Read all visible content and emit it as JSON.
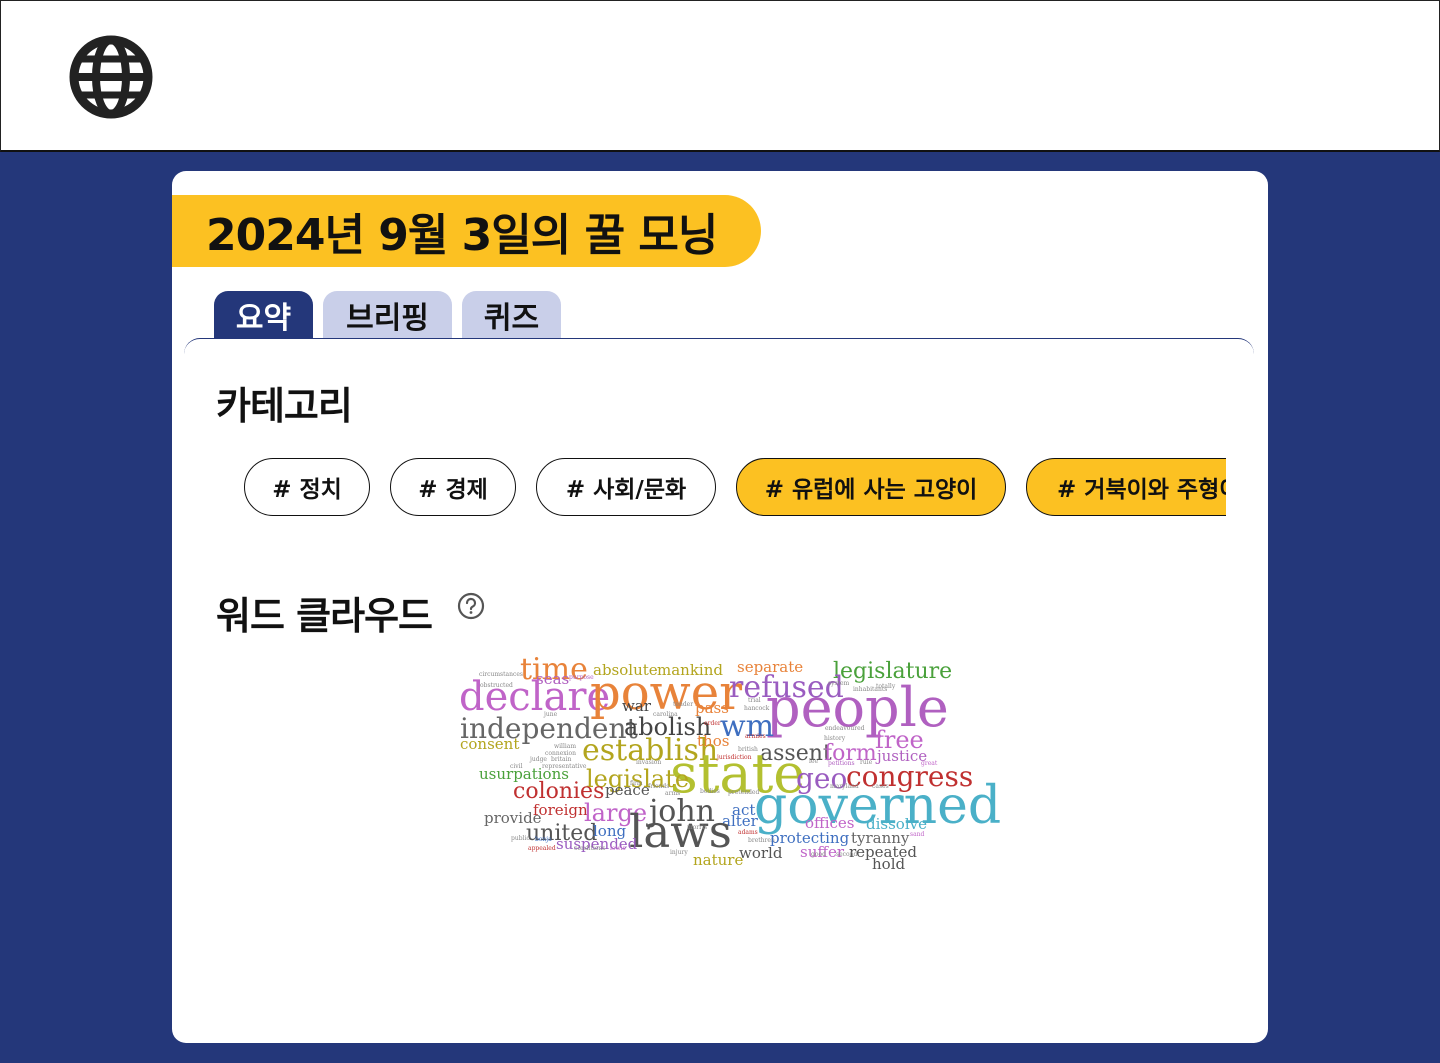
{
  "header": {
    "logo_icon": "globe-icon"
  },
  "banner": {
    "title": "2024년 9월 3일의 꿀 모닝",
    "color": "#fcc122"
  },
  "tabs": [
    {
      "label": "요약",
      "active": true
    },
    {
      "label": "브리핑",
      "active": false
    },
    {
      "label": "퀴즈",
      "active": false
    }
  ],
  "category": {
    "title": "카테고리",
    "chips": [
      {
        "label": "# 정치",
        "style": "white"
      },
      {
        "label": "# 경제",
        "style": "white"
      },
      {
        "label": "# 사회/문화",
        "style": "white"
      },
      {
        "label": "# 유럽에 사는 고양이",
        "style": "yellow"
      },
      {
        "label": "# 거북이와 주형이",
        "style": "yellow"
      }
    ]
  },
  "wordcloud": {
    "title": "워드 클라우드",
    "help_icon": "question-circle-icon",
    "words": [
      {
        "t": "time",
        "c": "#e8833a"
      },
      {
        "t": "absolute",
        "c": "#b3a51e"
      },
      {
        "t": "mankind",
        "c": "#b3a51e"
      },
      {
        "t": "separate",
        "c": "#e8833a"
      },
      {
        "t": "legislature",
        "c": "#4aa13b"
      },
      {
        "t": "circumstances",
        "c": "#888"
      },
      {
        "t": "seas",
        "c": "#b060c0"
      },
      {
        "t": "purpose",
        "c": "#b060c0"
      },
      {
        "t": "obstructed",
        "c": "#888"
      },
      {
        "t": "declare",
        "c": "#c064c8"
      },
      {
        "t": "power",
        "c": "#e8833a"
      },
      {
        "t": "refused",
        "c": "#9a5cc0"
      },
      {
        "t": "system",
        "c": "#888"
      },
      {
        "t": "inhabitants",
        "c": "#888"
      },
      {
        "t": "totally",
        "c": "#888"
      },
      {
        "t": "people",
        "c": "#b060c0"
      },
      {
        "t": "war",
        "c": "#444"
      },
      {
        "t": "tender",
        "c": "#888"
      },
      {
        "t": "pass",
        "c": "#e8833a"
      },
      {
        "t": "trial",
        "c": "#888"
      },
      {
        "t": "hancock",
        "c": "#888"
      },
      {
        "t": "june",
        "c": "#888"
      },
      {
        "t": "carolina",
        "c": "#888"
      },
      {
        "t": "independent",
        "c": "#666"
      },
      {
        "t": "abolish",
        "c": "#444"
      },
      {
        "t": "order",
        "c": "#c03030"
      },
      {
        "t": "wm",
        "c": "#3f6fc0"
      },
      {
        "t": "endeavoured",
        "c": "#888"
      },
      {
        "t": "history",
        "c": "#888"
      },
      {
        "t": "consent",
        "c": "#b3a51e"
      },
      {
        "t": "establish",
        "c": "#b3a51e"
      },
      {
        "t": "thos",
        "c": "#e8833a"
      },
      {
        "t": "armies",
        "c": "#c03030"
      },
      {
        "t": "free",
        "c": "#c064c8"
      },
      {
        "t": "william",
        "c": "#888"
      },
      {
        "t": "connexion",
        "c": "#888"
      },
      {
        "t": "assent",
        "c": "#555"
      },
      {
        "t": "form",
        "c": "#c064c8"
      },
      {
        "t": "justice",
        "c": "#b060c0"
      },
      {
        "t": "judge",
        "c": "#888"
      },
      {
        "t": "britain",
        "c": "#888"
      },
      {
        "t": "jurisdiction",
        "c": "#c03030"
      },
      {
        "t": "british",
        "c": "#888"
      },
      {
        "t": "representative",
        "c": "#888"
      },
      {
        "t": "invasion",
        "c": "#888"
      },
      {
        "t": "civil",
        "c": "#888"
      },
      {
        "t": "state",
        "c": "#b3c030"
      },
      {
        "t": "lee",
        "c": "#888"
      },
      {
        "t": "petitions",
        "c": "#b060c0"
      },
      {
        "t": "rule",
        "c": "#888"
      },
      {
        "t": "great",
        "c": "#c064c8"
      },
      {
        "t": "usurpations",
        "c": "#4aa13b"
      },
      {
        "t": "legislate",
        "c": "#b3a51e"
      },
      {
        "t": "geo",
        "c": "#9a5cc0"
      },
      {
        "t": "congress",
        "c": "#c03030"
      },
      {
        "t": "firm",
        "c": "#888"
      },
      {
        "t": "friends",
        "c": "#888"
      },
      {
        "t": "maryland",
        "c": "#888"
      },
      {
        "t": "cases",
        "c": "#888"
      },
      {
        "t": "colonies",
        "c": "#c03030"
      },
      {
        "t": "peace",
        "c": "#555"
      },
      {
        "t": "arms",
        "c": "#888"
      },
      {
        "t": "bodies",
        "c": "#888"
      },
      {
        "t": "pretended",
        "c": "#888"
      },
      {
        "t": "foreign",
        "c": "#c03030"
      },
      {
        "t": "large",
        "c": "#c064c8"
      },
      {
        "t": "john",
        "c": "#555"
      },
      {
        "t": "act",
        "c": "#3f6fc0"
      },
      {
        "t": "governed",
        "c": "#4ab0c8"
      },
      {
        "t": "provide",
        "c": "#666"
      },
      {
        "t": "alter",
        "c": "#3f6fc0"
      },
      {
        "t": "offices",
        "c": "#c064c8"
      },
      {
        "t": "dissolve",
        "c": "#4ab0c8"
      },
      {
        "t": "united",
        "c": "#555"
      },
      {
        "t": "long",
        "c": "#3f6fc0"
      },
      {
        "t": "laws",
        "c": "#555"
      },
      {
        "t": "morris",
        "c": "#888"
      },
      {
        "t": "adams",
        "c": "#c03030"
      },
      {
        "t": "brethren",
        "c": "#888"
      },
      {
        "t": "protecting",
        "c": "#3f6fc0"
      },
      {
        "t": "tyranny",
        "c": "#666"
      },
      {
        "t": "sand",
        "c": "#c064c8"
      },
      {
        "t": "public",
        "c": "#888"
      },
      {
        "t": "benja",
        "c": "#3f6fc0"
      },
      {
        "t": "suspended",
        "c": "#9a5cc0"
      },
      {
        "t": "suffer",
        "c": "#c064c8"
      },
      {
        "t": "repeated",
        "c": "#555"
      },
      {
        "t": "appealed",
        "c": "#c03030"
      },
      {
        "t": "conditions",
        "c": "#888"
      },
      {
        "t": "lewis",
        "c": "#c064c8"
      },
      {
        "t": "injury",
        "c": "#888"
      },
      {
        "t": "nature",
        "c": "#b3a51e"
      },
      {
        "t": "world",
        "c": "#555"
      },
      {
        "t": "good",
        "c": "#888"
      },
      {
        "t": "second",
        "c": "#888"
      },
      {
        "t": "hold",
        "c": "#555"
      }
    ]
  }
}
